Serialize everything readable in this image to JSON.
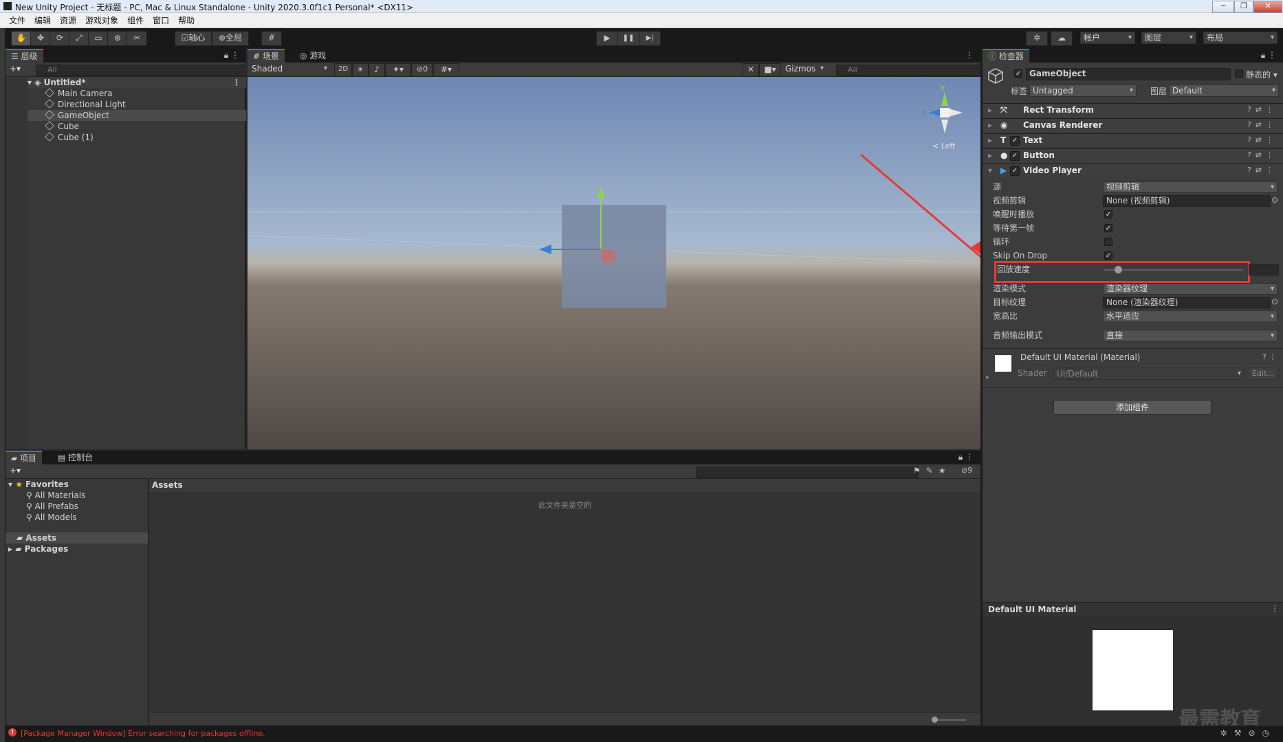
{
  "window": {
    "title": "New Unity Project - 无标题 - PC, Mac & Linux Standalone - Unity 2020.3.0f1c1 Personal* <DX11>",
    "controls": [
      "─",
      "❐",
      "✕"
    ]
  },
  "menu": [
    "文件",
    "编辑",
    "资源",
    "游戏对象",
    "组件",
    "窗口",
    "帮助"
  ],
  "toolbar": {
    "tools": [
      "✋",
      "✥",
      "⟳",
      "⤢",
      "▭",
      "⊕",
      "✂"
    ],
    "pivot_label": "轴心",
    "global_label": "全局",
    "grid_icon": "#",
    "play": "▶",
    "pause": "❚❚",
    "step": "▶|",
    "account_label": "帐户",
    "layers_label": "图层",
    "layout_label": "布局"
  },
  "hierarchy": {
    "tab_label": "层级",
    "search_placeholder": "All",
    "scene_name": "Untitled*",
    "items": [
      "Main Camera",
      "Directional Light",
      "GameObject",
      "Cube",
      "Cube (1)"
    ],
    "selected": "GameObject"
  },
  "scene": {
    "tab_scene": "场景",
    "tab_game": "游戏",
    "shading_mode": "Shaded",
    "mode_2d": "2D",
    "hidden_count": "0",
    "gizmos_label": "Gizmos",
    "search_placeholder": "All",
    "gizmo_view_label": "< Left",
    "gizmo_axes": {
      "y": "y",
      "z": "z"
    }
  },
  "inspector": {
    "tab_label": "检查器",
    "object_name": "GameObject",
    "static_label": "静态的",
    "tag_label": "标签",
    "tag_value": "Untagged",
    "layer_label": "图层",
    "layer_value": "Default",
    "components": [
      {
        "name": "Rect Transform",
        "icon": "⤧"
      },
      {
        "name": "Canvas Renderer",
        "icon": "◉"
      },
      {
        "name": "Text",
        "icon": "T"
      },
      {
        "name": "Button",
        "icon": "●"
      },
      {
        "name": "Video Player",
        "icon": "▶"
      }
    ],
    "video_player": {
      "source_label": "源",
      "source_value": "视频剪辑",
      "clip_label": "视频剪辑",
      "clip_value": "None (视频剪辑)",
      "play_on_awake_label": "唤醒时播放",
      "play_on_awake": true,
      "wait_first_frame_label": "等待第一帧",
      "wait_first_frame": true,
      "loop_label": "循环",
      "loop": false,
      "skip_on_drop_label": "Skip On Drop",
      "skip_on_drop": true,
      "playback_speed_label": "回放速度",
      "playback_speed_fraction": 0.1,
      "render_mode_label": "渲染模式",
      "render_mode_value": "渲染器纹理",
      "target_texture_label": "目标纹理",
      "target_texture_value": "None (渲染器纹理)",
      "aspect_ratio_label": "宽高比",
      "aspect_ratio_value": "水平适应",
      "audio_output_label": "音频输出模式",
      "audio_output_value": "直接"
    },
    "material": {
      "name": "Default UI Material (Material)",
      "shader_label": "Shader",
      "shader_value": "UI/Default",
      "edit_label": "Edit..."
    },
    "add_component_label": "添加组件",
    "preview_title": "Default UI Material"
  },
  "project": {
    "tab_project": "项目",
    "tab_console": "控制台",
    "favorites_label": "Favorites",
    "favorites": [
      "All Materials",
      "All Prefabs",
      "All Models"
    ],
    "folders": [
      "Assets",
      "Packages"
    ],
    "breadcrumb": "Assets",
    "empty_message": "此文件夹是空的",
    "hidden_count": "9"
  },
  "status": {
    "error_message": "[Package Manager Window] Error searching for packages offline."
  },
  "watermark": "最需教育",
  "colors": {
    "highlight_box": "#e53935",
    "arrow": "#e53935",
    "selection": "#2c5d87",
    "accent": "#3a79bb"
  }
}
